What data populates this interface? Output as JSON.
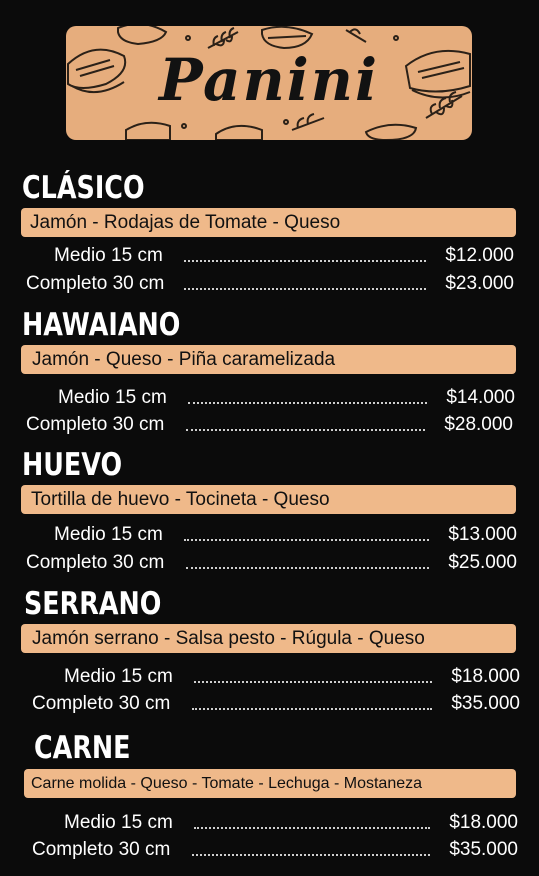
{
  "banner": {
    "title": "Panini"
  },
  "sections": [
    {
      "title": "CLÁSICO",
      "ingredients": "Jamón - Rodajas de Tomate -  Queso",
      "sizes": [
        {
          "label": "Medio 15 cm",
          "price": "$12.000"
        },
        {
          "label": "Completo 30 cm",
          "price": "$23.000"
        }
      ]
    },
    {
      "title": "HAWAIANO",
      "ingredients": "Jamón - Queso - Piña caramelizada",
      "sizes": [
        {
          "label": "Medio 15 cm",
          "price": "$14.000"
        },
        {
          "label": "Completo 30 cm",
          "price": "$28.000"
        }
      ]
    },
    {
      "title": "HUEVO",
      "ingredients": "Tortilla de huevo - Tocineta - Queso",
      "sizes": [
        {
          "label": "Medio 15 cm",
          "price": "$13.000"
        },
        {
          "label": "Completo 30 cm",
          "price": "$25.000"
        }
      ]
    },
    {
      "title": "SERRANO",
      "ingredients": "Jamón serrano - Salsa pesto - Rúgula - Queso",
      "sizes": [
        {
          "label": "Medio 15 cm",
          "price": "$18.000"
        },
        {
          "label": "Completo 30 cm",
          "price": "$35.000"
        }
      ]
    },
    {
      "title": "CARNE",
      "ingredients": "Carne molida - Queso - Tomate -  Lechuga - Mostaneza",
      "sizes": [
        {
          "label": "Medio 15 cm",
          "price": "$18.000"
        },
        {
          "label": "Completo 30 cm",
          "price": "$35.000"
        }
      ]
    }
  ]
}
